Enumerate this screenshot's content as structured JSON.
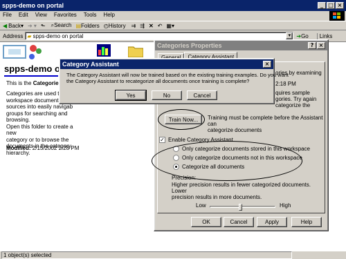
{
  "window": {
    "title": "spps-demo on portal"
  },
  "menu": [
    "File",
    "Edit",
    "View",
    "Favorites",
    "Tools",
    "Help"
  ],
  "toolbar": {
    "back": "Back",
    "search": "Search",
    "folders": "Folders",
    "history": "History"
  },
  "address": {
    "label": "Address",
    "value": "spps-demo on portal",
    "go": "Go",
    "links": "Links"
  },
  "page": {
    "heading": "spps-demo on",
    "intro_prefix": "This is the ",
    "intro_bold": "Categories",
    "intro_suffix": " fo",
    "desc_lines": [
      "Categories are used to or",
      "workspace documents an",
      "sources into easily navigab",
      "groups for searching and browsing.",
      "Open this folder to create a new",
      "category or to browse the",
      "documents in the category",
      "hierarchy."
    ],
    "modified_label": "Modified:",
    "modified_value": "2/15/2002 2:28 PM"
  },
  "status": {
    "text": "1 object(s) selected"
  },
  "props": {
    "title": "Categories Properties",
    "tabs": [
      "General",
      "Category Assistant"
    ],
    "text1": "ories by examining",
    "text2": "2:18 PM",
    "text3_lines": [
      "quires sample",
      "gories.  Try again",
      "categorize the"
    ],
    "train_button": "Train Now...",
    "train_note_lines": [
      "Training must be complete before the Assistant can",
      "categorize documents"
    ],
    "enable_label": "Enable Category Assistant",
    "opt1": "Only categorize documents stored in this workspace",
    "opt2": "Only categorize documents not in this workspace",
    "opt3": "Categorize all documents",
    "precision_label": "Precision:",
    "precision_note_lines": [
      "Higher precision results in fewer categorized documents. Lower",
      "precision results in more documents."
    ],
    "low": "Low",
    "high": "High",
    "precision_level": 0.47,
    "ok": "OK",
    "cancel": "Cancel",
    "apply": "Apply",
    "help": "Help"
  },
  "dialog": {
    "title": "Category Assistant",
    "message_lines": [
      "The Category Assistant will now be trained based on the existing training examples.  Do you want",
      "the Category Assistant to recategorize all documents once training is complete?"
    ],
    "yes": "Yes",
    "no": "No",
    "cancel": "Cancel"
  },
  "colors": {
    "active_title": "#0a246a",
    "face": "#d4d0c8",
    "accent_blue": "#0000cc"
  }
}
